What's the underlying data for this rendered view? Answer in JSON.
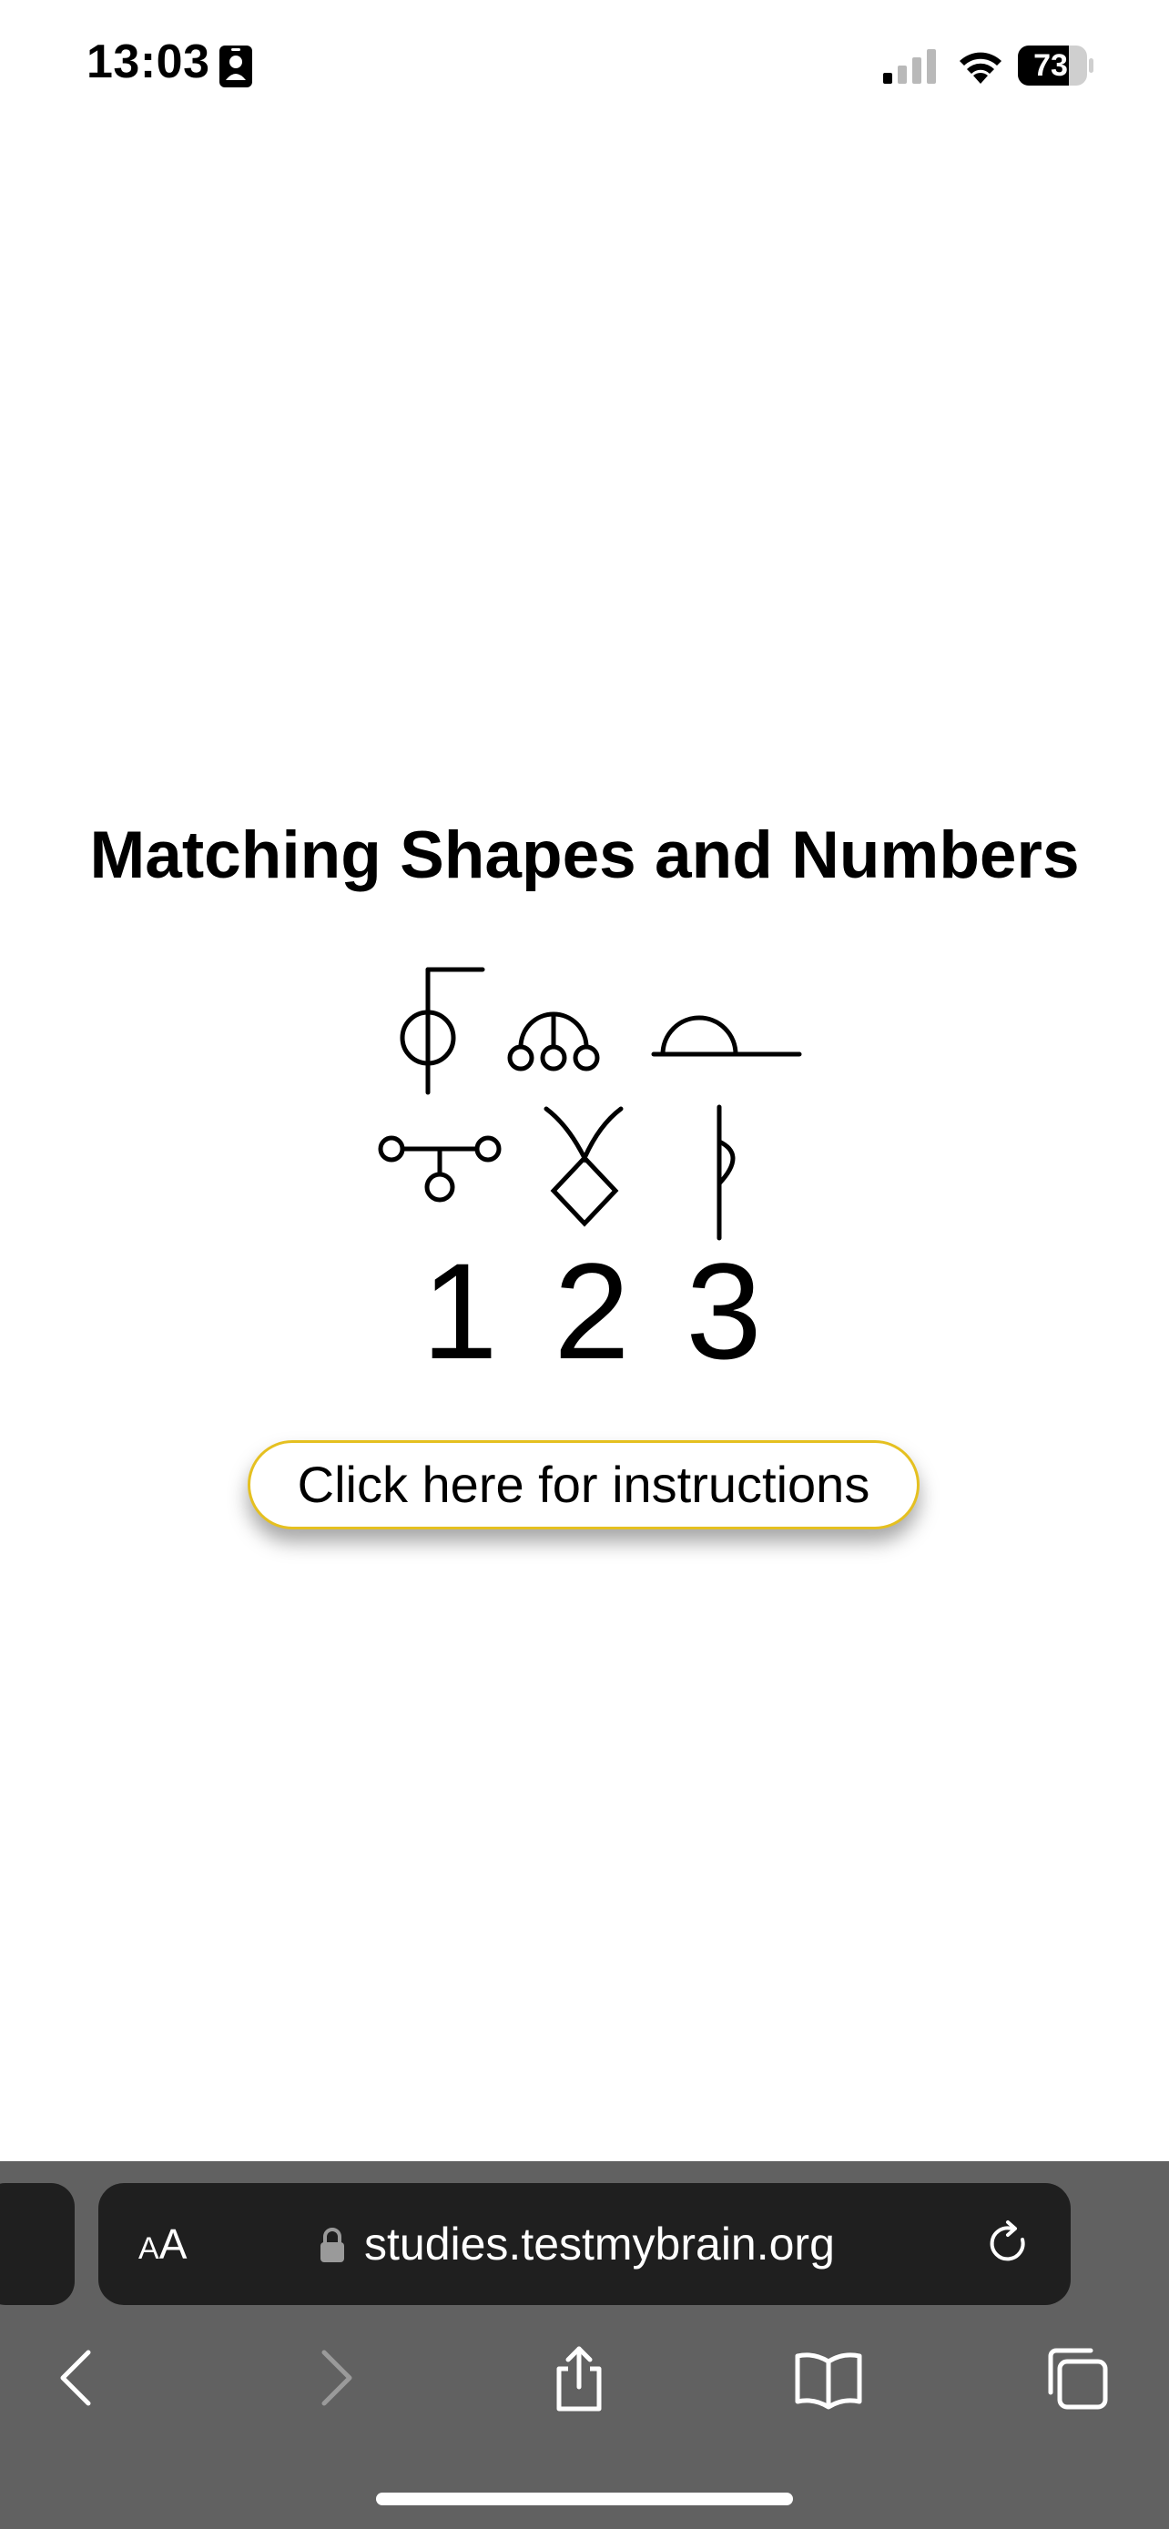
{
  "status_bar": {
    "time": "13:03",
    "battery_level": "73",
    "icons": [
      "id-card-icon",
      "cellular-signal-icon",
      "wifi-icon",
      "battery-icon"
    ]
  },
  "page": {
    "title": "Matching Shapes and Numbers",
    "numbers": [
      "1",
      "2",
      "3"
    ],
    "instructions_button_label": "Click here for instructions"
  },
  "browser": {
    "text_size_label_small": "A",
    "text_size_label_large": "A",
    "url": "studies.testmybrain.org",
    "toolbar": [
      "back-icon",
      "forward-icon",
      "share-icon",
      "bookmarks-icon",
      "tabs-icon"
    ]
  },
  "colors": {
    "button_border": "#e5c020",
    "chrome_background": "#616161",
    "address_bar_background": "#1f1f1f"
  }
}
